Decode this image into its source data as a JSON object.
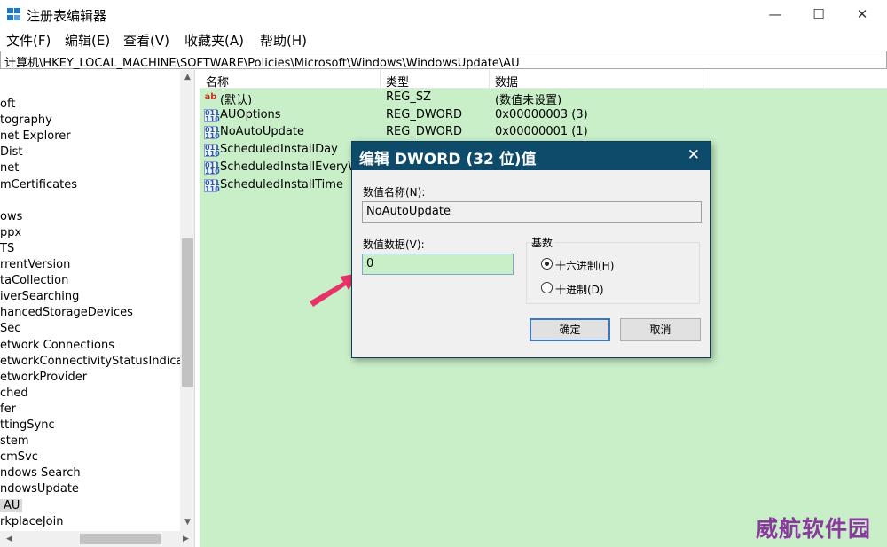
{
  "window": {
    "title": "注册表编辑器",
    "minimize": "—",
    "maximize": "☐",
    "close": "✕"
  },
  "menu": [
    "文件(F)",
    "编辑(E)",
    "查看(V)",
    "收藏夹(A)",
    "帮助(H)"
  ],
  "address": "计算机\\HKEY_LOCAL_MACHINE\\SOFTWARE\\Policies\\Microsoft\\Windows\\WindowsUpdate\\AU",
  "tree": {
    "items": [
      "oft",
      "tography",
      "net Explorer",
      "Dist",
      "net",
      "mCertificates",
      "",
      "ows",
      "ppx",
      "TS",
      "rrentVersion",
      "taCollection",
      "iverSearching",
      "hancedStorageDevices",
      "Sec",
      "etwork Connections",
      "etworkConnectivityStatusIndicator",
      "etworkProvider",
      "ched",
      "fer",
      "ttingSync",
      "stem",
      "cmSvc",
      "ndows Search",
      "ndowsUpdate",
      "AU",
      "rkplaceJoin"
    ],
    "selected_index": 25
  },
  "list": {
    "columns": [
      "名称",
      "类型",
      "数据"
    ],
    "rows": [
      {
        "icon": "string-value-icon",
        "name": "(默认)",
        "type": "REG_SZ",
        "data": "(数值未设置)"
      },
      {
        "icon": "dword-value-icon",
        "name": "AUOptions",
        "type": "REG_DWORD",
        "data": "0x00000003 (3)"
      },
      {
        "icon": "dword-value-icon",
        "name": "NoAutoUpdate",
        "type": "REG_DWORD",
        "data": "0x00000001 (1)"
      },
      {
        "icon": "dword-value-icon",
        "name": "ScheduledInstallDay",
        "type": "",
        "data": ""
      },
      {
        "icon": "dword-value-icon",
        "name": "ScheduledInstallEveryWe",
        "type": "",
        "data": ""
      },
      {
        "icon": "dword-value-icon",
        "name": "ScheduledInstallTime",
        "type": "",
        "data": ""
      }
    ]
  },
  "dialog": {
    "title": "编辑 DWORD (32 位)值",
    "close": "✕",
    "name_label": "数值名称(N):",
    "name_value": "NoAutoUpdate",
    "data_label": "数值数据(V):",
    "data_value": "0",
    "base_label": "基数",
    "radio_hex": "十六进制(H)",
    "radio_dec": "十进制(D)",
    "ok": "确定",
    "cancel": "取消"
  },
  "watermark": "威航软件园",
  "colors": {
    "list_bg": "#c9efc9",
    "dialog_title": "#0e4b6b",
    "arrow": "#e8336a"
  }
}
